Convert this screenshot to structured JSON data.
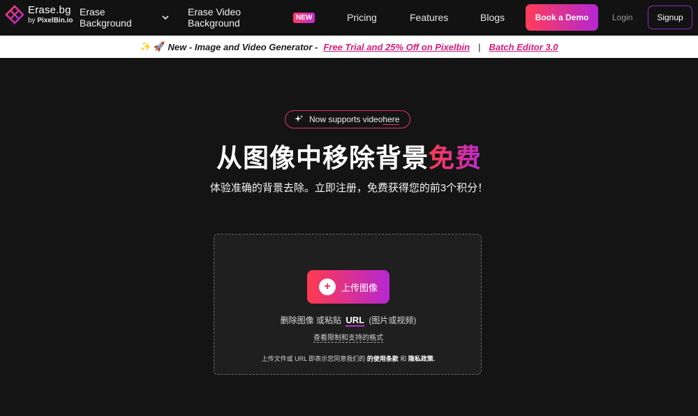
{
  "header": {
    "logo_title": "Erase.bg",
    "logo_by": "by",
    "logo_brand": "PixelBin.io",
    "tool_menu_line1": "Erase",
    "tool_menu_line2": "Background",
    "video_line1": "Erase Video",
    "video_line2": "Background",
    "new_badge": "NEW",
    "pricing": "Pricing",
    "features": "Features",
    "blogs": "Blogs",
    "book_demo": "Book a Demo",
    "login": "Login",
    "signup": "Signup"
  },
  "announcement": {
    "emoji": "✨ 🚀",
    "text": "New - Image and Video Generator -",
    "link1": "Free Trial and 25% Off on Pixelbin",
    "separator": "|",
    "link2": "Batch Editor 3.0"
  },
  "hero": {
    "pill_text": "Now supports video ",
    "pill_link": "here",
    "title_main": "从图像中移除背景",
    "title_highlight": "免费",
    "subtitle": "体验准确的背景去除。立即注册，免费获得您的前3个积分！"
  },
  "upload": {
    "button_label": "上传图像",
    "hint_prefix": "删除图像 或粘贴",
    "hint_url": "URL",
    "hint_suffix": "(图片或视频)",
    "limits_link": "查看限制和支持的格式",
    "terms_prefix": "上传文件或 URL 即表示您同意我们的",
    "terms_link": "的使用条款",
    "terms_and": "和",
    "privacy_link": "隐私政策."
  },
  "colors": {
    "accent_start": "#ff3b4f",
    "accent_end": "#b727d2",
    "background": "#141414"
  }
}
